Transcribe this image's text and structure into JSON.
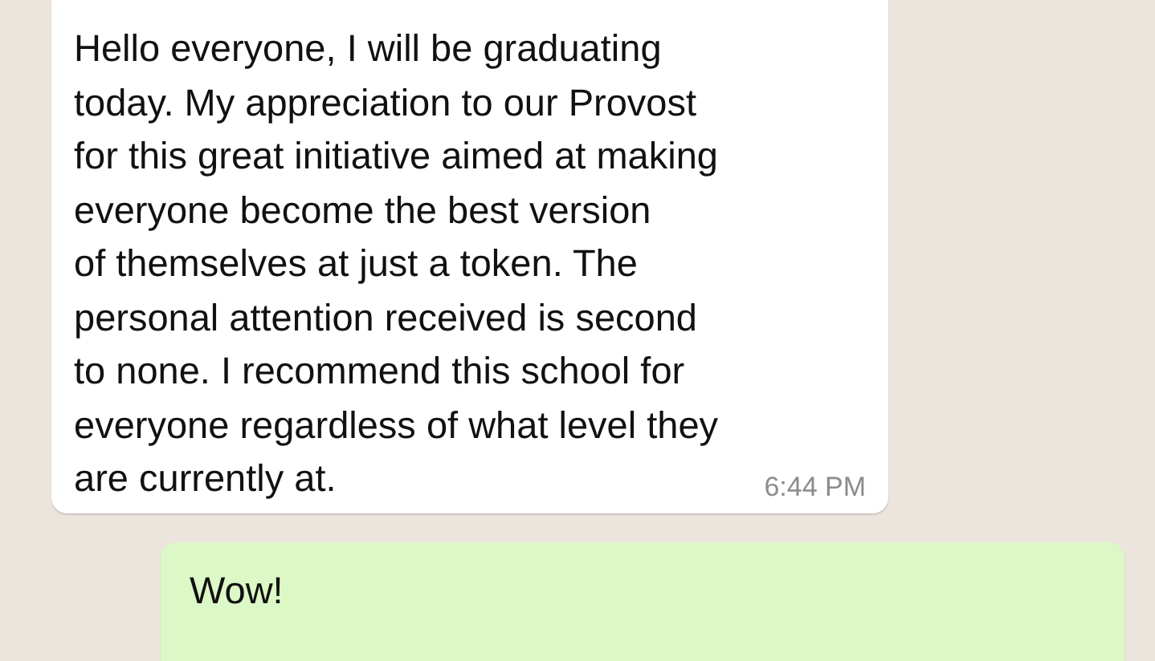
{
  "messages": [
    {
      "kind": "incoming",
      "text": "Hello everyone, I will be graduating\ntoday. My appreciation to our Provost\nfor this great initiative aimed at making\neveryone become the best version\nof themselves at just a token. The\npersonal attention received is second\nto none. I recommend this school for\neveryone regardless of what level they\nare currently at.",
      "time": "6:44 PM"
    },
    {
      "kind": "outgoing",
      "text": "Wow!"
    }
  ]
}
